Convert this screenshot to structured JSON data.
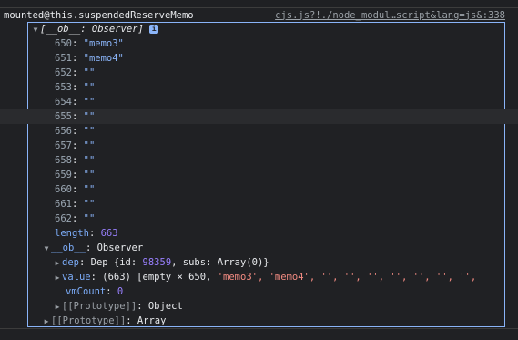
{
  "header": {
    "label": "mounted@this.suspendedReserveMemo",
    "source": "cjs.js?!./node_modul…script&lang=js&:338"
  },
  "array": {
    "summary_open": "[__ob__: Observer]",
    "info_glyph": "i",
    "items": [
      {
        "key": "650",
        "value": "\"memo3\""
      },
      {
        "key": "651",
        "value": "\"memo4\""
      },
      {
        "key": "652",
        "value": "\"\""
      },
      {
        "key": "653",
        "value": "\"\""
      },
      {
        "key": "654",
        "value": "\"\""
      },
      {
        "key": "655",
        "value": "\"\""
      },
      {
        "key": "656",
        "value": "\"\""
      },
      {
        "key": "657",
        "value": "\"\""
      },
      {
        "key": "658",
        "value": "\"\""
      },
      {
        "key": "659",
        "value": "\"\""
      },
      {
        "key": "660",
        "value": "\"\""
      },
      {
        "key": "661",
        "value": "\"\""
      },
      {
        "key": "662",
        "value": "\"\""
      }
    ],
    "length_key": "length",
    "length_value": "663"
  },
  "ob": {
    "key": "__ob__",
    "type": "Observer",
    "dep_key": "dep",
    "dep_prefix": "Dep {id: ",
    "dep_id": "98359",
    "dep_suffix": ", subs: Array(0)}",
    "value_key": "value",
    "value_count": "(663)",
    "value_preview_start": "[empty × 650, ",
    "value_preview_strs": "'memo3', 'memo4', '', '', '', '', '', '', '',",
    "vmcount_key": "vmCount",
    "vmcount_value": "0",
    "proto_key": "[[Prototype]]",
    "proto_value": "Object"
  },
  "outer_proto": {
    "key": "[[Prototype]]",
    "value": "Array"
  },
  "colors": {
    "accent_border": "#8ab4f8",
    "background": "#202124"
  }
}
